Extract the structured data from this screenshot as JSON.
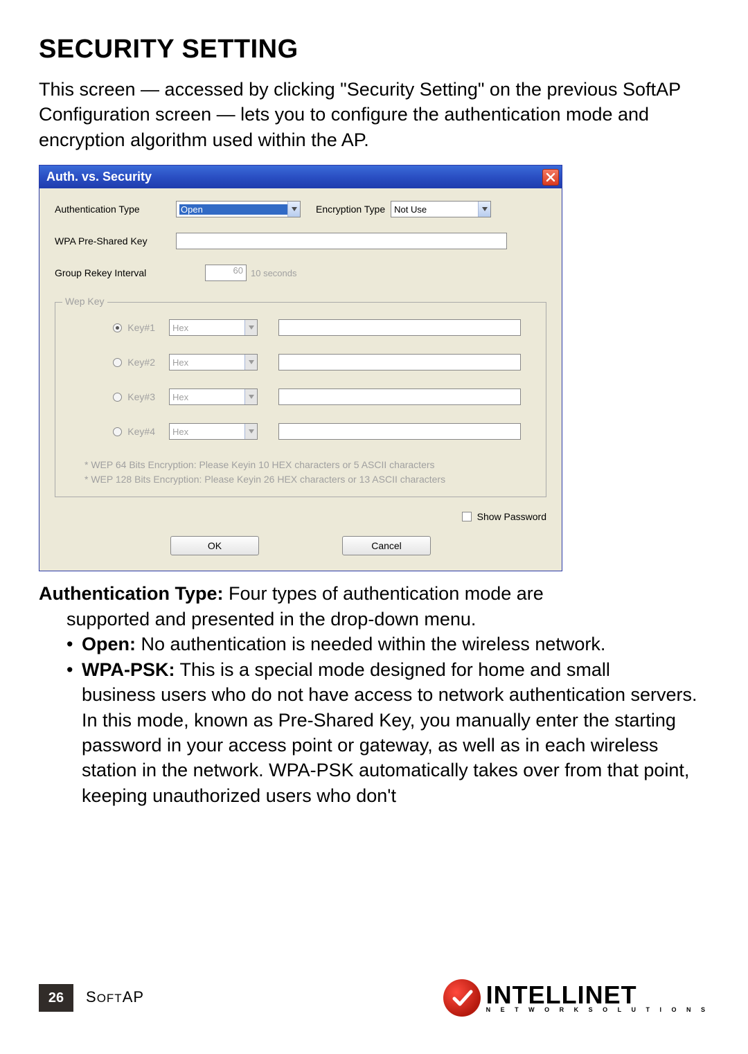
{
  "heading": "SECURITY SETTING",
  "intro": "This screen — accessed by clicking \"Security Setting\" on the previous SoftAP Configuration screen — lets you to configure the authentication mode and encryption algorithm used within the AP.",
  "dialog": {
    "title": "Auth. vs. Security",
    "auth_label": "Authentication Type",
    "auth_value": "Open",
    "enc_label": "Encryption Type",
    "enc_value": "Not Use",
    "psk_label": "WPA Pre-Shared Key",
    "psk_value": "",
    "rekey_label": "Group Rekey Interval",
    "rekey_value": "60",
    "rekey_unit": "10 seconds",
    "wep_legend": "Wep Key",
    "wep_keys": [
      {
        "label": "Key#1",
        "fmt": "Hex",
        "val": "",
        "checked": true
      },
      {
        "label": "Key#2",
        "fmt": "Hex",
        "val": "",
        "checked": false
      },
      {
        "label": "Key#3",
        "fmt": "Hex",
        "val": "",
        "checked": false
      },
      {
        "label": "Key#4",
        "fmt": "Hex",
        "val": "",
        "checked": false
      }
    ],
    "wep_note_1": "* WEP 64 Bits Encryption:  Please Keyin 10 HEX characters or 5 ASCII characters",
    "wep_note_2": "* WEP 128 Bits Encryption:  Please Keyin 26 HEX characters or 13 ASCII characters",
    "show_pwd": "Show Password",
    "ok": "OK",
    "cancel": "Cancel"
  },
  "doc": {
    "auth_type_label": "Authentication Type:",
    "auth_type_text1": " Four types of authentication mode are",
    "auth_type_text2": "supported and presented in the drop-down menu.",
    "open_label": "Open:",
    "open_text": " No authentication is needed within the wireless network.",
    "wpa_label": "WPA-PSK:",
    "wpa_text_1": " This is a special mode designed for home and small",
    "wpa_text_rest": "business users who do not have access to network authentication servers. In this mode, known as Pre-Shared Key, you manually enter the starting password in your access point or gateway, as well as in each wireless station in the network. WPA-PSK automatically takes over from that point, keeping unauthorized users who don't"
  },
  "footer": {
    "page": "26",
    "section_s": "S",
    "section_rest": "OFT",
    "section_ap": "AP",
    "brand": "INTELLINET",
    "brand_sub": "N E T W O R K   S O L U T I O N S"
  }
}
